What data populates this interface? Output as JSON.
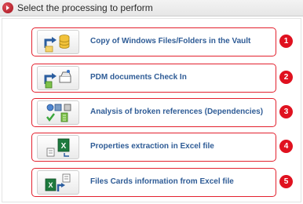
{
  "window": {
    "title": "Select the processing to perform"
  },
  "actions": [
    {
      "label": "Copy of Windows Files/Folders in the Vault",
      "badge": "1",
      "icon": "copy-to-vault-icon"
    },
    {
      "label": "PDM documents Check In",
      "badge": "2",
      "icon": "check-in-icon"
    },
    {
      "label": "Analysis of broken references (Dependencies)",
      "badge": "3",
      "icon": "dependencies-analysis-icon"
    },
    {
      "label": "Properties extraction in Excel file",
      "badge": "4",
      "icon": "excel-export-icon"
    },
    {
      "label": "Files Cards information from Excel file",
      "badge": "5",
      "icon": "excel-import-icon"
    }
  ],
  "colors": {
    "highlight_border": "#e3212e",
    "badge": "#e0111f",
    "label": "#2f5c96"
  }
}
